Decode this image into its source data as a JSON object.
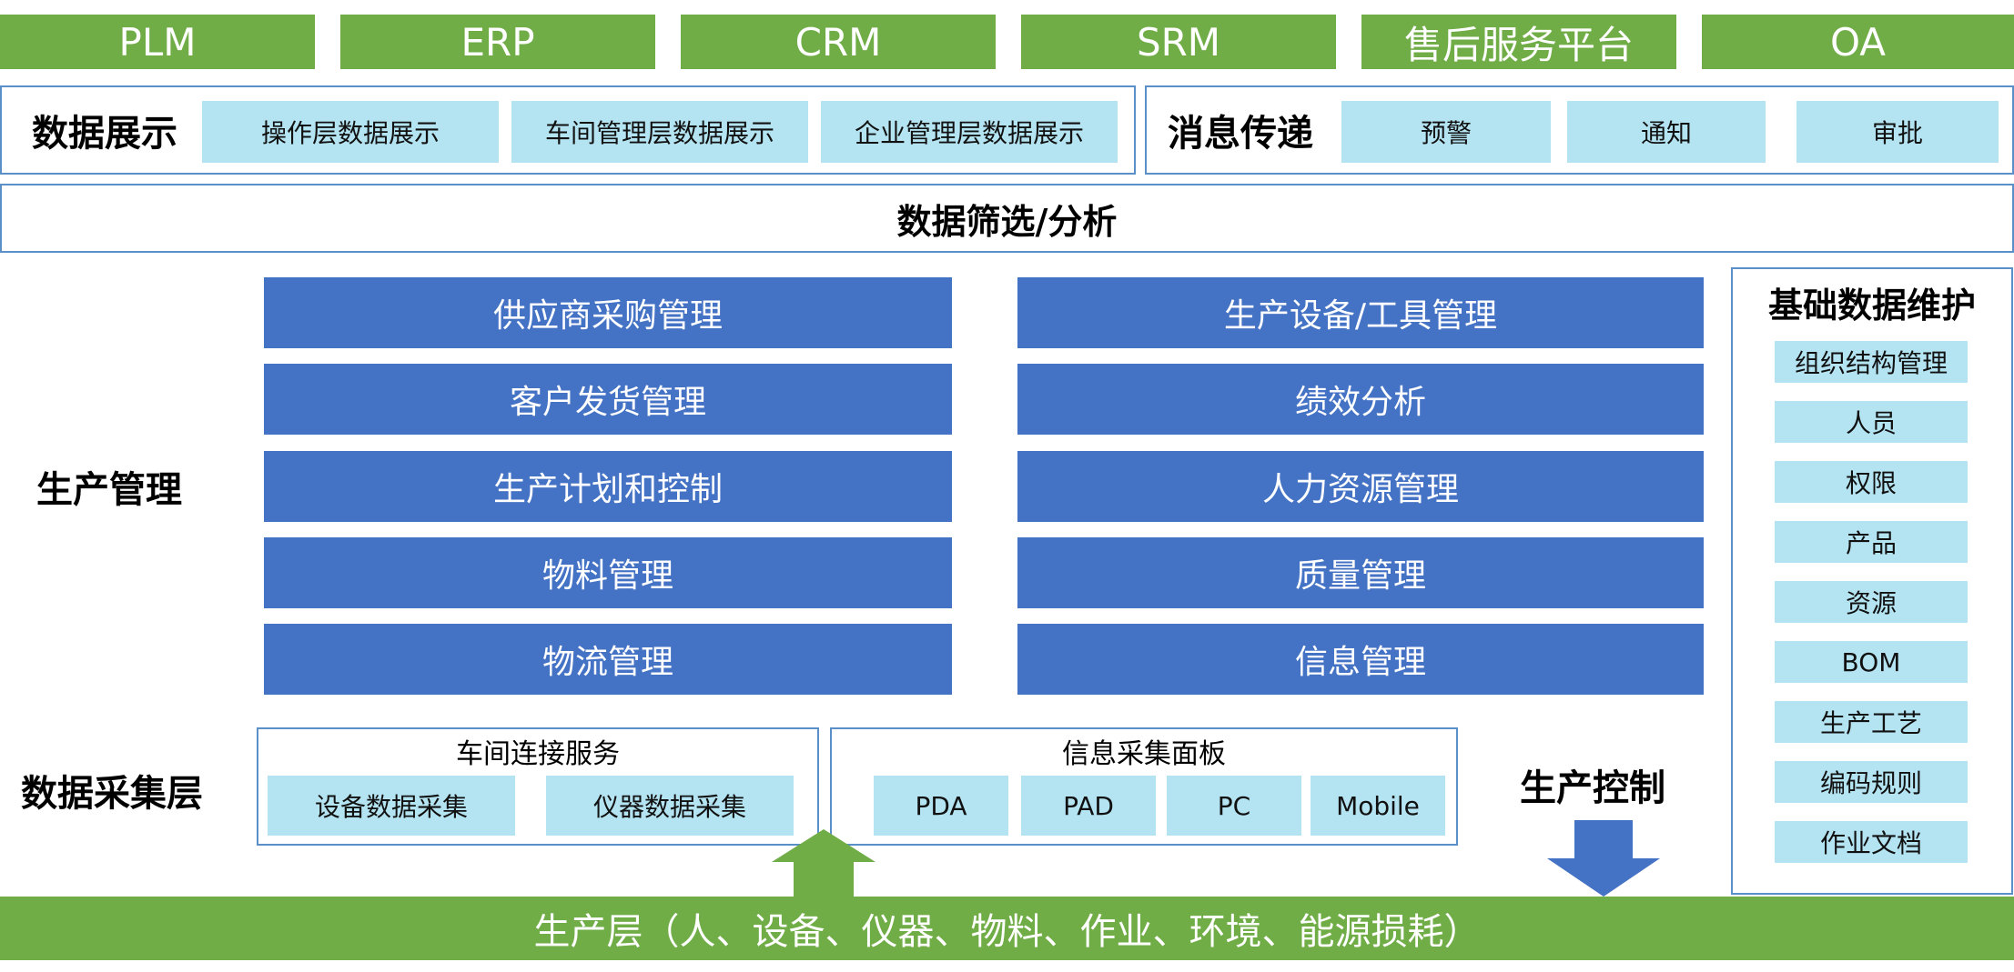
{
  "top_systems": [
    "PLM",
    "ERP",
    "CRM",
    "SRM",
    "售后服务平台",
    "OA"
  ],
  "data_display": {
    "label": "数据展示",
    "items": [
      "操作层数据展示",
      "车间管理层数据展示",
      "企业管理层数据展示"
    ]
  },
  "messaging": {
    "label": "消息传递",
    "items": [
      "预警",
      "通知",
      "审批"
    ]
  },
  "filter_bar": "数据筛选/分析",
  "production_management": {
    "label": "生产管理",
    "left": [
      "供应商采购管理",
      "客户发货管理",
      "生产计划和控制",
      "物料管理",
      "物流管理"
    ],
    "right": [
      "生产设备/工具管理",
      "绩效分析",
      "人力资源管理",
      "质量管理",
      "信息管理"
    ]
  },
  "base_data": {
    "title": "基础数据维护",
    "items": [
      "组织结构管理",
      "人员",
      "权限",
      "产品",
      "资源",
      "BOM",
      "生产工艺",
      "编码规则",
      "作业文档"
    ]
  },
  "data_collection": {
    "label": "数据采集层",
    "workshop": {
      "title": "车间连接服务",
      "items": [
        "设备数据采集",
        "仪器数据采集"
      ]
    },
    "panel": {
      "title": "信息采集面板",
      "items": [
        "PDA",
        "PAD",
        "PC",
        "Mobile"
      ]
    }
  },
  "production_control": "生产控制",
  "production_layer": "生产层（人、设备、仪器、物料、作业、环境、能源损耗）",
  "colors": {
    "green": "#70ad47",
    "blue": "#4472c4",
    "light_blue": "#b4e3f2",
    "border": "#5b8fc7"
  }
}
